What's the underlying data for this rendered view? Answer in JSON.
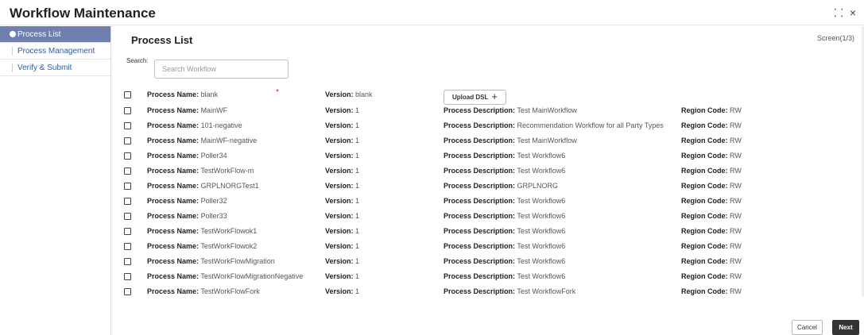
{
  "app": {
    "title": "Workflow Maintenance"
  },
  "window": {
    "expand_icon": "expand-arrows-icon",
    "close_icon": "close-icon",
    "expand_glyph": "⸬",
    "close_glyph": "×"
  },
  "sidebar": {
    "items": [
      {
        "label": "Process List",
        "active": true
      },
      {
        "label": "Process Management",
        "active": false
      },
      {
        "label": "Verify & Submit",
        "active": false
      }
    ]
  },
  "main": {
    "title": "Process List",
    "screen_indicator": "Screen(1/3)",
    "search": {
      "label": "Search:",
      "placeholder": "Search Workflow",
      "value": ""
    }
  },
  "labels": {
    "name": "Process Name:",
    "version": "Version:",
    "description": "Process Description:",
    "region": "Region Code:"
  },
  "first_row": {
    "name": "blank",
    "version": "blank",
    "required_mark": "*",
    "upload_label": "Upload DSL",
    "upload_plus": "+"
  },
  "processes": [
    {
      "name": "MainWF",
      "version": "1",
      "description": "Test MainWorkflow",
      "region": "RW"
    },
    {
      "name": "101-negative",
      "version": "1",
      "description": "Recommendation Workflow for all Party Types",
      "region": "RW"
    },
    {
      "name": "MainWF-negative",
      "version": "1",
      "description": "Test MainWorkflow",
      "region": "RW"
    },
    {
      "name": "Poller34",
      "version": "1",
      "description": "Test Workflow6",
      "region": "RW"
    },
    {
      "name": "TestWorkFlow-m",
      "version": "1",
      "description": "Test Workflow6",
      "region": "RW"
    },
    {
      "name": "GRPLNORGTest1",
      "version": "1",
      "description": "GRPLNORG",
      "region": "RW"
    },
    {
      "name": "Poller32",
      "version": "1",
      "description": "Test Workflow6",
      "region": "RW"
    },
    {
      "name": "Poller33",
      "version": "1",
      "description": "Test Workflow6",
      "region": "RW"
    },
    {
      "name": "TestWorkFlowok1",
      "version": "1",
      "description": "Test Workflow6",
      "region": "RW"
    },
    {
      "name": "TestWorkFlowok2",
      "version": "1",
      "description": "Test Workflow6",
      "region": "RW"
    },
    {
      "name": "TestWorkFlowMigration",
      "version": "1",
      "description": "Test Workflow6",
      "region": "RW"
    },
    {
      "name": "TestWorkFlowMigrationNegative",
      "version": "1",
      "description": "Test Workflow6",
      "region": "RW"
    },
    {
      "name": "TestWorkFlowFork",
      "version": "1",
      "description": "Test WorkflowFork",
      "region": "RW"
    }
  ],
  "footer": {
    "cancel_label": "Cancel",
    "next_label": "Next"
  }
}
